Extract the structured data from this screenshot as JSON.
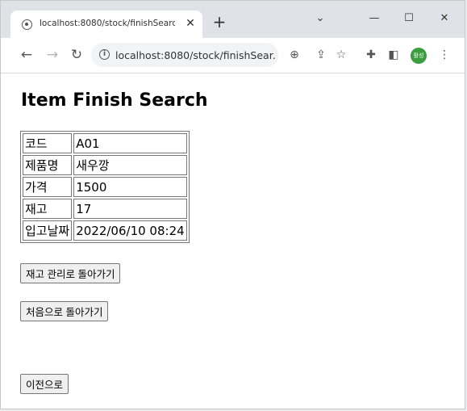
{
  "browser": {
    "tab_title": "localhost:8080/stock/finishSearc",
    "new_tab": "+",
    "url": "localhost:8080/stock/finishSear...",
    "avatar_text": "활성",
    "avatar_color": "#3a9d3e"
  },
  "page": {
    "title": "Item Finish Search",
    "rows": [
      {
        "label": "코드",
        "value": "A01"
      },
      {
        "label": "제품명",
        "value": "새우깡"
      },
      {
        "label": "가격",
        "value": "1500"
      },
      {
        "label": "재고",
        "value": "17"
      },
      {
        "label": "입고날짜",
        "value": "2022/06/10 08:24"
      }
    ],
    "buttons": {
      "back_to_stock": "재고 관리로 돌아가기",
      "back_to_home": "처음으로 돌아가기",
      "previous": "이전으로"
    }
  }
}
